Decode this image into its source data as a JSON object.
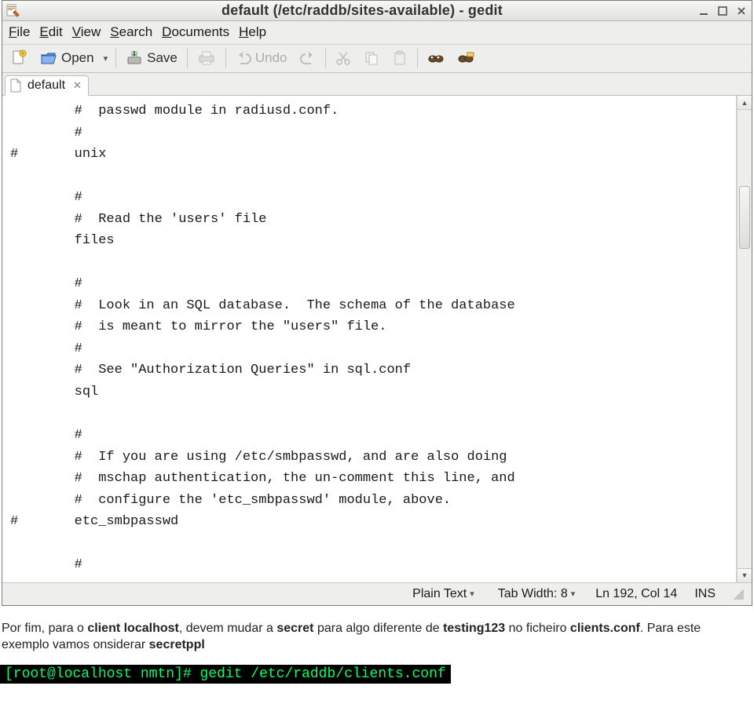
{
  "title_bar": {
    "title": "default (/etc/raddb/sites-available) - gedit"
  },
  "menu": {
    "file": {
      "label": "File",
      "underline": "F"
    },
    "edit": {
      "label": "Edit",
      "underline": "E"
    },
    "view": {
      "label": "View",
      "underline": "V"
    },
    "search": {
      "label": "Search",
      "underline": "S"
    },
    "documents": {
      "label": "Documents",
      "underline": "D"
    },
    "help": {
      "label": "Help",
      "underline": "H"
    }
  },
  "toolbar": {
    "open_label": "Open",
    "save_label": "Save",
    "undo_label": "Undo"
  },
  "tab": {
    "label": "default"
  },
  "editor": {
    "content": "        #  passwd module in radiusd.conf.\n        #\n#       unix\n\n        #\n        #  Read the 'users' file\n        files\n\n        #\n        #  Look in an SQL database.  The schema of the database\n        #  is meant to mirror the \"users\" file.\n        #\n        #  See \"Authorization Queries\" in sql.conf\n        sql\n\n        #\n        #  If you are using /etc/smbpasswd, and are also doing\n        #  mschap authentication, the un-comment this line, and\n        #  configure the 'etc_smbpasswd' module, above.\n#       etc_smbpasswd\n\n        #"
  },
  "status": {
    "syntax": "Plain Text",
    "tabwidth": "Tab Width: 8",
    "position": "Ln 192, Col 14",
    "mode": "INS"
  },
  "doc": {
    "p1_a": "Por fim, para o ",
    "p1_b": "client localhost",
    "p1_c": ", devem mudar a ",
    "p1_d": "secret",
    "p1_e": " para algo diferente de ",
    "p1_f": "testing123",
    "p1_g": " no ficheiro ",
    "p1_h": "clients.conf",
    "p1_i": ". Para este exemplo vamos onsiderar ",
    "p1_j": "secretppl"
  },
  "terminal": {
    "line": "[root@localhost nmtn]# gedit /etc/raddb/clients.conf"
  }
}
